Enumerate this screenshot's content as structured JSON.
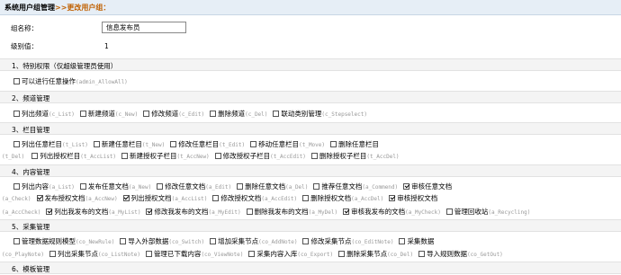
{
  "title": {
    "main": "系统用户组管理",
    "sep": ">>",
    "sub": "更改用户组："
  },
  "group_name": {
    "label": "组名称：",
    "value": "信息发布员"
  },
  "level": {
    "label": "级别值：",
    "value": "1"
  },
  "sections": [
    {
      "title": "1、特别权限（仅超级管理员使用）"
    },
    {
      "title": "2、频道管理"
    },
    {
      "title": "3、栏目管理"
    },
    {
      "title": "4、内容管理"
    },
    {
      "title": "5、采集管理"
    },
    {
      "title": "6、模板管理"
    }
  ],
  "permissions": {
    "special": [
      {
        "label": "可以进行任意操作",
        "code": "(admin_AllowAll)",
        "checked": false
      }
    ],
    "channel": [
      {
        "label": "列出频道",
        "code": "(c_List)",
        "checked": false
      },
      {
        "label": "新建频道",
        "code": "(c_New)",
        "checked": false
      },
      {
        "label": "修改频道",
        "code": "(c_Edit)",
        "checked": false
      },
      {
        "label": "删除频道",
        "code": "(c_Del)",
        "checked": false
      },
      {
        "label": "联动类别管理",
        "code": "(c_Stepselect)",
        "checked": false
      }
    ],
    "column_line1": [
      {
        "label": "列出任意栏目",
        "code": "(t_List)",
        "checked": false
      },
      {
        "label": "新建任意栏目",
        "code": "(t_New)",
        "checked": false
      },
      {
        "label": "修改任意栏目",
        "code": "(t_Edit)",
        "checked": false
      },
      {
        "label": "移动任意栏目",
        "code": "(t_Move)",
        "checked": false
      },
      {
        "label": "删除任意栏目",
        "code": "",
        "checked": false
      }
    ],
    "column_line2_prefix": "(t_Del)",
    "column_line2": [
      {
        "label": "列出授权栏目",
        "code": "(t_AccList)",
        "checked": false
      },
      {
        "label": "新建授权子栏目",
        "code": "(t_AccNew)",
        "checked": false
      },
      {
        "label": "修改授权子栏目",
        "code": "(t_AccEdit)",
        "checked": false
      },
      {
        "label": "删除授权子栏目",
        "code": "(t_AccDel)",
        "checked": false
      }
    ],
    "content_line1": [
      {
        "label": "列出内容",
        "code": "(a_List)",
        "checked": false
      },
      {
        "label": "发布任意文档",
        "code": "(a_New)",
        "checked": false
      },
      {
        "label": "修改任意文档",
        "code": "(a_Edit)",
        "checked": false
      },
      {
        "label": "删除任意文档",
        "code": "(a_Del)",
        "checked": false
      },
      {
        "label": "推荐任意文档",
        "code": "(a_Commend)",
        "checked": false
      },
      {
        "label": "审核任意文档",
        "code": "",
        "checked": true
      }
    ],
    "content_line2_prefix": "(a_Check)",
    "content_line2": [
      {
        "label": "发布授权文档",
        "code": "(a_AccNew)",
        "checked": true
      },
      {
        "label": "列出授权文档",
        "code": "(a_AccList)",
        "checked": true
      },
      {
        "label": "修改授权文档",
        "code": "(a_AccEdit)",
        "checked": false
      },
      {
        "label": "删除授权文档",
        "code": "(a_AccDel)",
        "checked": false
      },
      {
        "label": "审核授权文档",
        "code": "",
        "checked": true
      }
    ],
    "content_line3_prefix": "(a_AccCheck)",
    "content_line3": [
      {
        "label": "列出我发布的文档",
        "code": "(a_MyList)",
        "checked": true
      },
      {
        "label": "修改我发布的文档",
        "code": "(a_MyEdit)",
        "checked": true
      },
      {
        "label": "删除我发布的文档",
        "code": "(a_MyDel)",
        "checked": false
      },
      {
        "label": "审核我发布的文档",
        "code": "(a_MyCheck)",
        "checked": true
      },
      {
        "label": "管理回收站",
        "code": "(a_Recycling)",
        "checked": false
      }
    ],
    "collect_line1": [
      {
        "label": "管理数据规则模型",
        "code": "(co_NewRule)",
        "checked": false
      },
      {
        "label": "导入外部数据",
        "code": "(co_Switch)",
        "checked": false
      },
      {
        "label": "增加采集节点",
        "code": "(co_AddNote)",
        "checked": false
      },
      {
        "label": "修改采集节点",
        "code": "(co_EditNote)",
        "checked": false
      },
      {
        "label": "采集数据",
        "code": "",
        "checked": false
      }
    ],
    "collect_line2_prefix": "(co_PlayNote)",
    "collect_line2": [
      {
        "label": "列出采集节点",
        "code": "(co_ListNote)",
        "checked": false
      },
      {
        "label": "管理已下载内容",
        "code": "(co_ViewNote)",
        "checked": false
      },
      {
        "label": "采集内容入库",
        "code": "(co_Export)",
        "checked": false
      },
      {
        "label": "删除采集节点",
        "code": "(co_Del)",
        "checked": false
      },
      {
        "label": "导入规则数据",
        "code": "(co_GetOut)",
        "checked": false
      }
    ]
  }
}
